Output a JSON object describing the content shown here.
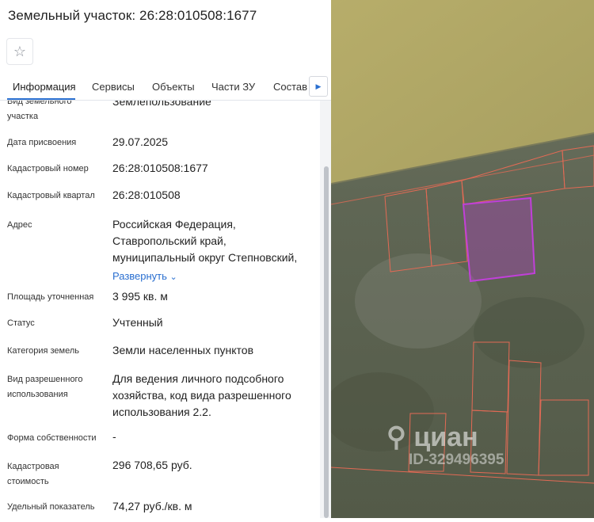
{
  "panel": {
    "title": "Земельный участок: 26:28:010508:1677",
    "favorite_icon": "star-icon",
    "tabs": [
      "Информация",
      "Сервисы",
      "Объекты",
      "Части ЗУ",
      "Состав"
    ],
    "tab_next_icon": "chevron-right-icon",
    "fields": {
      "usage_type": {
        "label": "Вид земельного участка",
        "value": "Землепользование"
      },
      "assign_date": {
        "label": "Дата присвоения",
        "value": "29.07.2025"
      },
      "cadastral_number": {
        "label": "Кадастровый номер",
        "value": "26:28:010508:1677"
      },
      "cadastral_quarter": {
        "label": "Кадастровый квартал",
        "value": "26:28:010508"
      },
      "address": {
        "label": "Адрес",
        "lines": [
          "Российская Федерация,",
          "Ставропольский край,",
          "муниципальный округ Степновский,"
        ],
        "expand_label": "Развернуть"
      },
      "area": {
        "label": "Площадь уточненная",
        "value": "3 995 кв. м"
      },
      "status": {
        "label": "Статус",
        "value": "Учтенный"
      },
      "land_category": {
        "label": "Категория земель",
        "value": "Земли населенных пунктов"
      },
      "permitted_use": {
        "label_lines": [
          "Вид разрешенного",
          "использования"
        ],
        "value_lines": [
          "Для ведения личного подсобного",
          "хозяйства, код вида разрешенного",
          "использования 2.2."
        ]
      },
      "ownership": {
        "label": "Форма собственности",
        "value": "-"
      },
      "cadastral_value": {
        "label_lines": [
          "Кадастровая",
          "стоимость"
        ],
        "value": "296 708,65 руб."
      },
      "specific_index": {
        "label": "Удельный показатель",
        "value": "74,27 руб./кв. м"
      }
    }
  },
  "map": {
    "watermark_brand": "циан",
    "watermark_id": "ID-329496395",
    "parcel_outline_color": "#e36a55",
    "highlight_color": "#b43cc8",
    "field_color": "#b9ae6b"
  }
}
